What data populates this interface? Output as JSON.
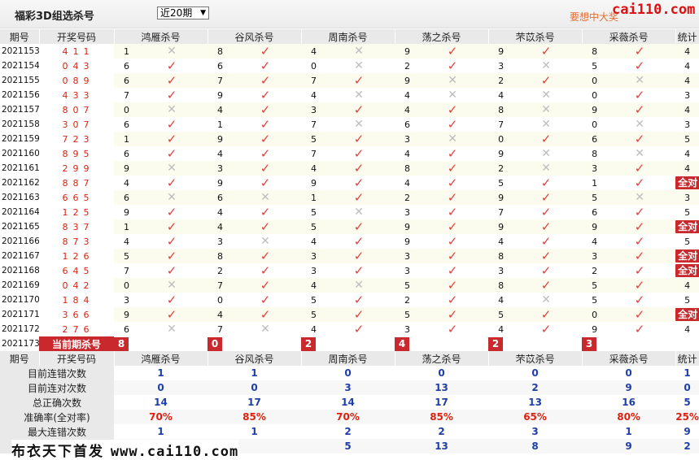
{
  "header": {
    "title": "福彩3D组选杀号",
    "period_select": "近20期",
    "promo": "要想中大奖",
    "watermark_top": "cai110.com",
    "watermark_bottom_cn": "布衣天下首发",
    "watermark_bottom_url": "www.cai110.com"
  },
  "columns": {
    "issue": "期号",
    "numbers": "开奖号码",
    "killers": [
      "鸿雁杀号",
      "谷风杀号",
      "周南杀号",
      "荡之杀号",
      "芣苡杀号",
      "采薇杀号"
    ],
    "stat": "统计"
  },
  "rows": [
    {
      "issue": "2021153",
      "nums": "411",
      "picks": [
        [
          "1",
          "x"
        ],
        [
          "8",
          "v"
        ],
        [
          "4",
          "x"
        ],
        [
          "9",
          "v"
        ],
        [
          "9",
          "v"
        ],
        [
          "8",
          "v"
        ]
      ],
      "stat": "4"
    },
    {
      "issue": "2021154",
      "nums": "043",
      "picks": [
        [
          "6",
          "v"
        ],
        [
          "6",
          "v"
        ],
        [
          "0",
          "x"
        ],
        [
          "2",
          "v"
        ],
        [
          "3",
          "x"
        ],
        [
          "5",
          "v"
        ]
      ],
      "stat": "4"
    },
    {
      "issue": "2021155",
      "nums": "089",
      "picks": [
        [
          "6",
          "v"
        ],
        [
          "7",
          "v"
        ],
        [
          "7",
          "v"
        ],
        [
          "9",
          "x"
        ],
        [
          "2",
          "v"
        ],
        [
          "0",
          "x"
        ]
      ],
      "stat": "4"
    },
    {
      "issue": "2021156",
      "nums": "433",
      "picks": [
        [
          "7",
          "v"
        ],
        [
          "9",
          "v"
        ],
        [
          "4",
          "x"
        ],
        [
          "4",
          "x"
        ],
        [
          "4",
          "x"
        ],
        [
          "0",
          "v"
        ]
      ],
      "stat": "3"
    },
    {
      "issue": "2021157",
      "nums": "807",
      "picks": [
        [
          "0",
          "x"
        ],
        [
          "4",
          "v"
        ],
        [
          "3",
          "v"
        ],
        [
          "4",
          "v"
        ],
        [
          "8",
          "x"
        ],
        [
          "9",
          "v"
        ]
      ],
      "stat": "4"
    },
    {
      "issue": "2021158",
      "nums": "307",
      "picks": [
        [
          "6",
          "v"
        ],
        [
          "1",
          "v"
        ],
        [
          "7",
          "x"
        ],
        [
          "6",
          "v"
        ],
        [
          "7",
          "x"
        ],
        [
          "0",
          "x"
        ]
      ],
      "stat": "3"
    },
    {
      "issue": "2021159",
      "nums": "723",
      "picks": [
        [
          "1",
          "v"
        ],
        [
          "9",
          "v"
        ],
        [
          "5",
          "v"
        ],
        [
          "3",
          "x"
        ],
        [
          "0",
          "v"
        ],
        [
          "6",
          "v"
        ]
      ],
      "stat": "5"
    },
    {
      "issue": "2021160",
      "nums": "895",
      "picks": [
        [
          "6",
          "v"
        ],
        [
          "4",
          "v"
        ],
        [
          "7",
          "v"
        ],
        [
          "4",
          "v"
        ],
        [
          "9",
          "x"
        ],
        [
          "8",
          "x"
        ]
      ],
      "stat": "4"
    },
    {
      "issue": "2021161",
      "nums": "299",
      "picks": [
        [
          "9",
          "x"
        ],
        [
          "3",
          "v"
        ],
        [
          "4",
          "v"
        ],
        [
          "8",
          "v"
        ],
        [
          "2",
          "x"
        ],
        [
          "3",
          "v"
        ]
      ],
      "stat": "4"
    },
    {
      "issue": "2021162",
      "nums": "887",
      "picks": [
        [
          "4",
          "v"
        ],
        [
          "9",
          "v"
        ],
        [
          "9",
          "v"
        ],
        [
          "4",
          "v"
        ],
        [
          "5",
          "v"
        ],
        [
          "1",
          "v"
        ]
      ],
      "stat": "全对"
    },
    {
      "issue": "2021163",
      "nums": "665",
      "picks": [
        [
          "6",
          "x"
        ],
        [
          "6",
          "x"
        ],
        [
          "1",
          "v"
        ],
        [
          "2",
          "v"
        ],
        [
          "9",
          "v"
        ],
        [
          "5",
          "x"
        ]
      ],
      "stat": "3"
    },
    {
      "issue": "2021164",
      "nums": "125",
      "picks": [
        [
          "9",
          "v"
        ],
        [
          "4",
          "v"
        ],
        [
          "5",
          "x"
        ],
        [
          "3",
          "v"
        ],
        [
          "7",
          "v"
        ],
        [
          "6",
          "v"
        ]
      ],
      "stat": "5"
    },
    {
      "issue": "2021165",
      "nums": "837",
      "picks": [
        [
          "1",
          "v"
        ],
        [
          "4",
          "v"
        ],
        [
          "5",
          "v"
        ],
        [
          "9",
          "v"
        ],
        [
          "9",
          "v"
        ],
        [
          "9",
          "v"
        ]
      ],
      "stat": "全对"
    },
    {
      "issue": "2021166",
      "nums": "873",
      "picks": [
        [
          "4",
          "v"
        ],
        [
          "3",
          "x"
        ],
        [
          "4",
          "v"
        ],
        [
          "9",
          "v"
        ],
        [
          "4",
          "v"
        ],
        [
          "4",
          "v"
        ]
      ],
      "stat": "5"
    },
    {
      "issue": "2021167",
      "nums": "126",
      "picks": [
        [
          "5",
          "v"
        ],
        [
          "8",
          "v"
        ],
        [
          "3",
          "v"
        ],
        [
          "3",
          "v"
        ],
        [
          "8",
          "v"
        ],
        [
          "3",
          "v"
        ]
      ],
      "stat": "全对"
    },
    {
      "issue": "2021168",
      "nums": "645",
      "picks": [
        [
          "7",
          "v"
        ],
        [
          "2",
          "v"
        ],
        [
          "3",
          "v"
        ],
        [
          "3",
          "v"
        ],
        [
          "3",
          "v"
        ],
        [
          "2",
          "v"
        ]
      ],
      "stat": "全对"
    },
    {
      "issue": "2021169",
      "nums": "042",
      "picks": [
        [
          "0",
          "x"
        ],
        [
          "7",
          "v"
        ],
        [
          "4",
          "x"
        ],
        [
          "5",
          "v"
        ],
        [
          "8",
          "v"
        ],
        [
          "5",
          "v"
        ]
      ],
      "stat": "4"
    },
    {
      "issue": "2021170",
      "nums": "184",
      "picks": [
        [
          "3",
          "v"
        ],
        [
          "0",
          "v"
        ],
        [
          "5",
          "v"
        ],
        [
          "2",
          "v"
        ],
        [
          "4",
          "x"
        ],
        [
          "5",
          "v"
        ]
      ],
      "stat": "5"
    },
    {
      "issue": "2021171",
      "nums": "366",
      "picks": [
        [
          "9",
          "v"
        ],
        [
          "4",
          "v"
        ],
        [
          "5",
          "v"
        ],
        [
          "5",
          "v"
        ],
        [
          "5",
          "v"
        ],
        [
          "0",
          "v"
        ]
      ],
      "stat": "全对"
    },
    {
      "issue": "2021172",
      "nums": "276",
      "picks": [
        [
          "6",
          "x"
        ],
        [
          "7",
          "x"
        ],
        [
          "4",
          "v"
        ],
        [
          "3",
          "v"
        ],
        [
          "4",
          "v"
        ],
        [
          "9",
          "v"
        ]
      ],
      "stat": "4"
    }
  ],
  "current": {
    "issue": "2021173",
    "label": "当前期杀号",
    "values": [
      "8",
      "0",
      "2",
      "4",
      "2",
      "3"
    ]
  },
  "summary": {
    "header_issue": "期号",
    "header_numbers": "开奖号码",
    "rows": [
      {
        "label": "目前连错次数",
        "values": [
          "1",
          "1",
          "0",
          "0",
          "0",
          "0"
        ],
        "stat": "1",
        "red": false
      },
      {
        "label": "目前连对次数",
        "values": [
          "0",
          "0",
          "3",
          "13",
          "2",
          "9"
        ],
        "stat": "0",
        "red": false
      },
      {
        "label": "总正确次数",
        "values": [
          "14",
          "17",
          "14",
          "17",
          "13",
          "16"
        ],
        "stat": "5",
        "red": false
      },
      {
        "label": "准确率(全对率)",
        "values": [
          "70%",
          "85%",
          "70%",
          "85%",
          "65%",
          "80%"
        ],
        "stat": "25%",
        "red": true
      },
      {
        "label": "最大连错次数",
        "values": [
          "1",
          "1",
          "2",
          "2",
          "3",
          "1"
        ],
        "stat": "9",
        "red": false
      },
      {
        "label": "",
        "values": [
          "",
          "",
          "5",
          "13",
          "8",
          "9"
        ],
        "stat": "2",
        "red": false
      }
    ]
  },
  "icons": {
    "check": "check-icon",
    "cross": "cross-icon"
  },
  "colors": {
    "accent_red": "#c9282d",
    "number_red": "#dd2211",
    "value_blue": "#1f3fa8",
    "promo_orange": "#e96b2c"
  }
}
